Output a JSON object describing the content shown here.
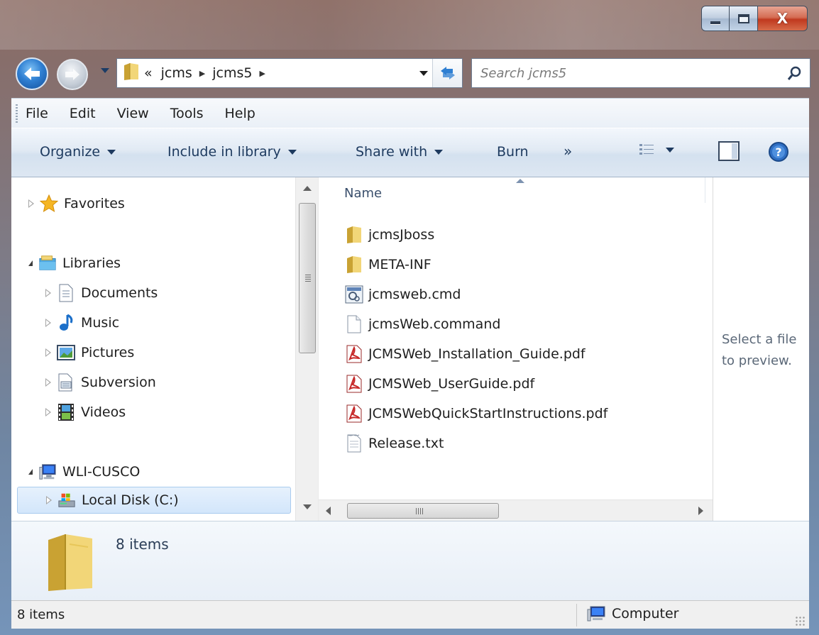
{
  "window": {
    "minimize_label": "",
    "maximize_label": "",
    "close_label": "X"
  },
  "nav": {
    "breadcrumb_overflow": "«",
    "breadcrumbs": [
      "jcms",
      "jcms5"
    ],
    "search_placeholder": "Search jcms5"
  },
  "menubar": {
    "items": [
      "File",
      "Edit",
      "View",
      "Tools",
      "Help"
    ]
  },
  "commandbar": {
    "organize": "Organize",
    "include_in_library": "Include in library",
    "share_with": "Share with",
    "burn": "Burn",
    "more": "»"
  },
  "navpane": {
    "favorites": "Favorites",
    "libraries": "Libraries",
    "library_items": [
      "Documents",
      "Music",
      "Pictures",
      "Subversion",
      "Videos"
    ],
    "computer": "WLI-CUSCO",
    "local_disk": "Local Disk (C:)"
  },
  "filelist": {
    "column_name": "Name",
    "files": [
      {
        "name": "jcmsJboss",
        "icon": "folder-icon"
      },
      {
        "name": "META-INF",
        "icon": "folder-icon"
      },
      {
        "name": "jcmsweb.cmd",
        "icon": "cmd-file-icon"
      },
      {
        "name": "jcmsWeb.command",
        "icon": "blank-file-icon"
      },
      {
        "name": "JCMSWeb_Installation_Guide.pdf",
        "icon": "pdf-file-icon"
      },
      {
        "name": "JCMSWeb_UserGuide.pdf",
        "icon": "pdf-file-icon"
      },
      {
        "name": "JCMSWebQuickStartInstructions.pdf",
        "icon": "pdf-file-icon"
      },
      {
        "name": "Release.txt",
        "icon": "text-file-icon"
      }
    ],
    "hscroll_grip": "III"
  },
  "preview": {
    "text": "Select a file to preview."
  },
  "details": {
    "count": "8 items"
  },
  "statusbar": {
    "left": "8 items",
    "right": "Computer"
  },
  "colors": {
    "accent": "#1d3a5f",
    "pdf_red": "#c62828",
    "folder_yellow": "#e7c659"
  }
}
